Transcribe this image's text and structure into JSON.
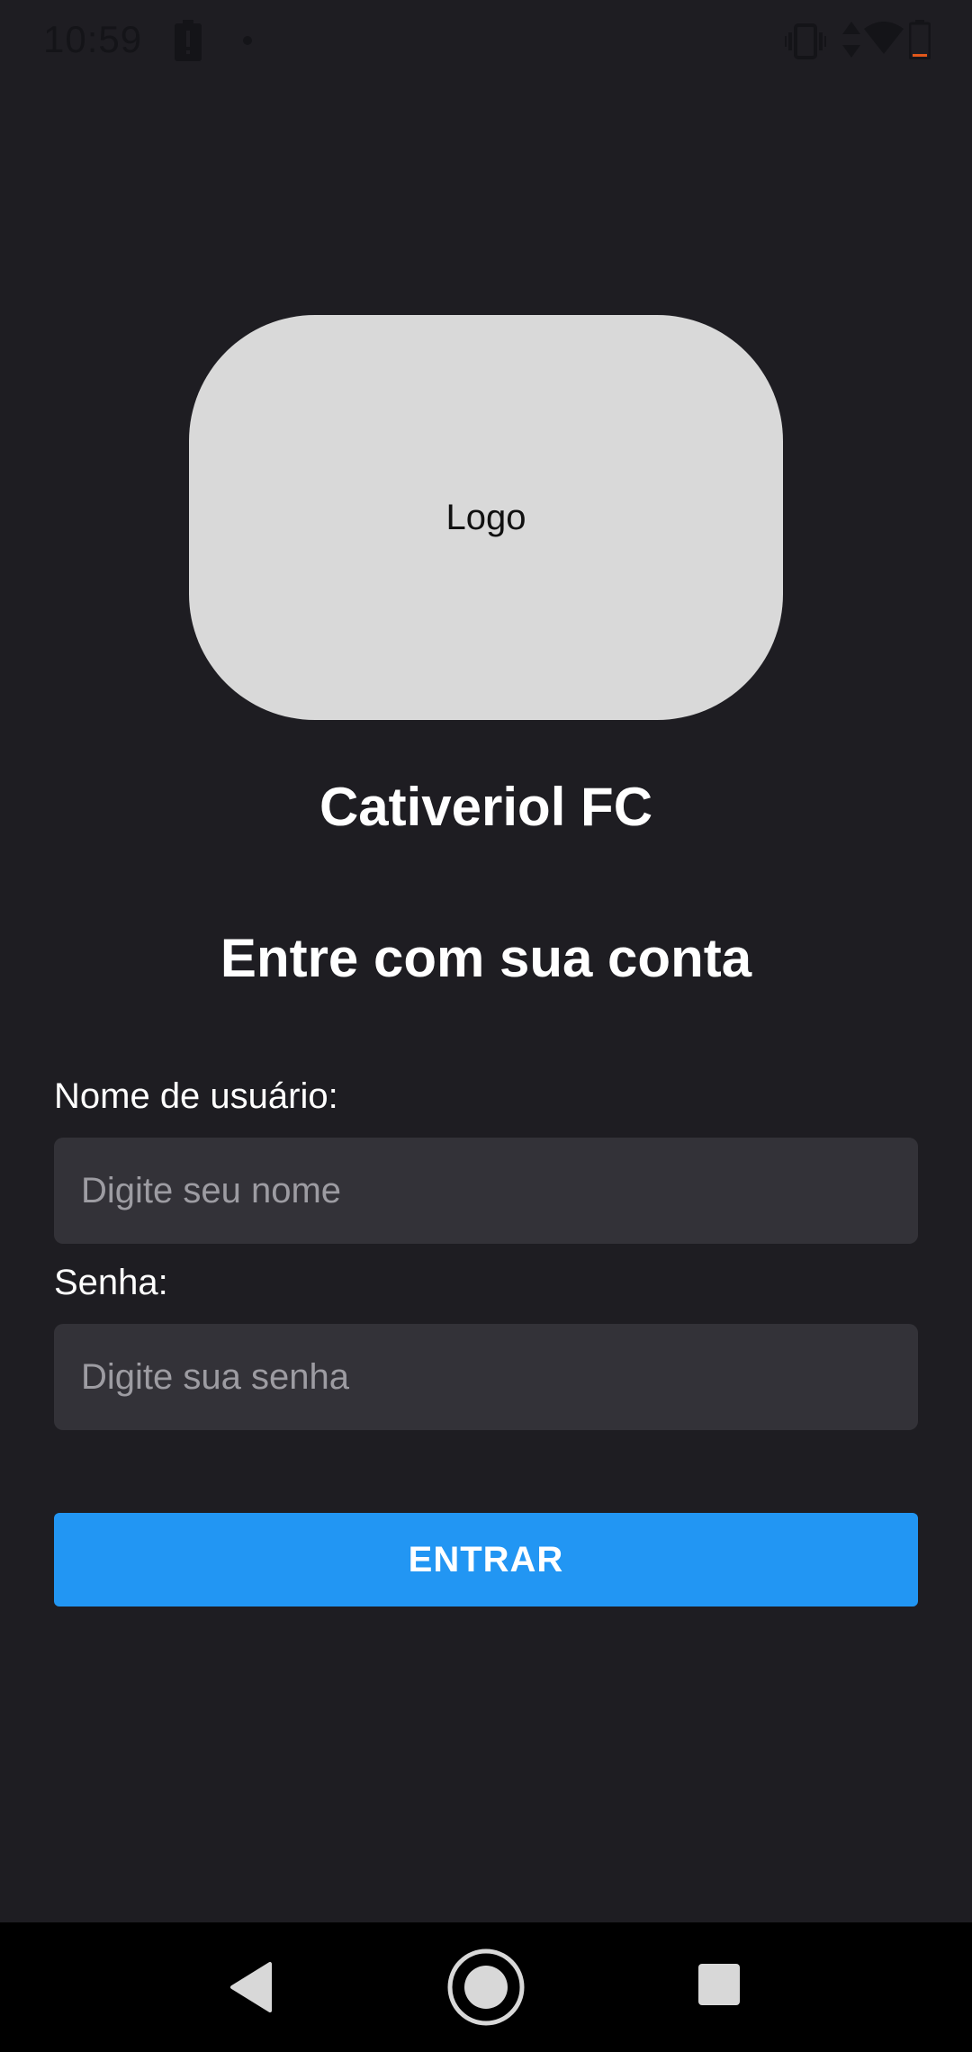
{
  "status_bar": {
    "time": "10:59",
    "icons": [
      "battery-alert-icon",
      "notification-dot-icon",
      "vibrate-icon",
      "data-arrows-icon",
      "wifi-icon",
      "battery-icon"
    ]
  },
  "logo": {
    "text": "Logo"
  },
  "app_name": "Cativeriol FC",
  "login_heading": "Entre com sua conta",
  "form": {
    "username_label": "Nome de usuário:",
    "username_placeholder": "Digite seu nome",
    "username_value": "",
    "password_label": "Senha:",
    "password_placeholder": "Digite sua senha",
    "password_value": "",
    "submit_label": "ENTRAR"
  },
  "nav_bar": {
    "icons": [
      "back-icon",
      "home-icon",
      "recents-icon"
    ]
  },
  "colors": {
    "background": "#1e1d22",
    "input_background": "#333238",
    "accent": "#2296f3",
    "logo_background": "#d9d9d9"
  }
}
